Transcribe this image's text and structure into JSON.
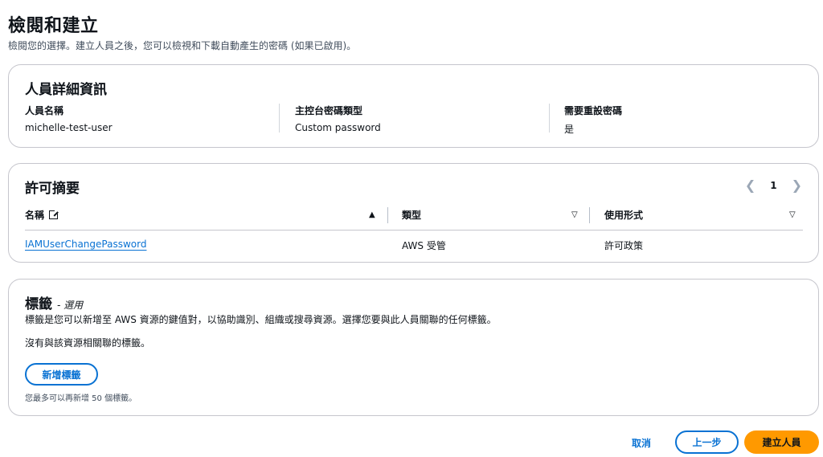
{
  "header": {
    "title": "檢閱和建立",
    "description": "檢閱您的選擇。建立人員之後，您可以檢視和下載自動產生的密碼 (如果已啟用)。"
  },
  "details": {
    "title": "人員詳細資訊",
    "fields": [
      {
        "label": "人員名稱",
        "value": "michelle-test-user"
      },
      {
        "label": "主控台密碼類型",
        "value": "Custom password"
      },
      {
        "label": "需要重設密碼",
        "value": "是"
      }
    ]
  },
  "permissions": {
    "title": "許可摘要",
    "page": "1",
    "columns": [
      "名稱",
      "類型",
      "使用形式"
    ],
    "rows": [
      {
        "name": "IAMUserChangePassword",
        "type": "AWS 受管",
        "usage": "許可政策"
      }
    ]
  },
  "tags": {
    "title": "標籤",
    "optional": "- 選用",
    "description": "標籤是您可以新增至 AWS 資源的鍵值對，以協助識別、組織或搜尋資源。選擇您要與此人員關聯的任何標籤。",
    "empty": "沒有與該資源相關聯的標籤。",
    "add_label": "新增標籤",
    "limit": "您最多可以再新增 50 個標籤。"
  },
  "footer": {
    "cancel": "取消",
    "back": "上一步",
    "create": "建立人員"
  },
  "colors": {
    "primary": "#ff9900",
    "link": "#0972d3",
    "border": "#c6c6cd"
  }
}
